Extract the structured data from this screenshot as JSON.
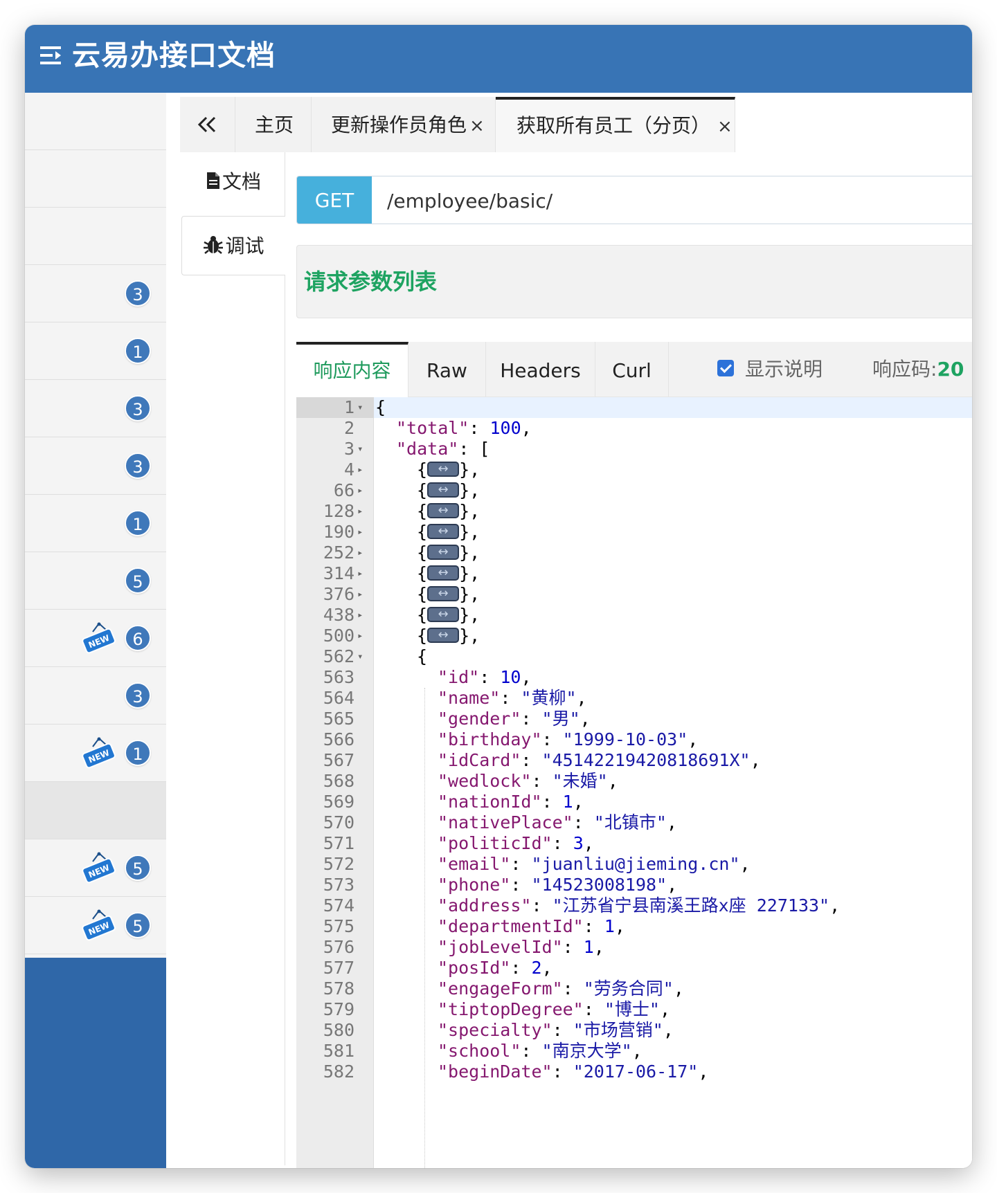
{
  "app": {
    "title": "云易办接口文档"
  },
  "sidebar": {
    "items": [
      {
        "badge": "",
        "is_new": false
      },
      {
        "badge": "",
        "is_new": false
      },
      {
        "badge": "",
        "is_new": false
      },
      {
        "badge": "3",
        "is_new": false
      },
      {
        "badge": "1",
        "is_new": false
      },
      {
        "badge": "3",
        "is_new": false
      },
      {
        "badge": "3",
        "is_new": false
      },
      {
        "badge": "1",
        "is_new": false
      },
      {
        "badge": "5",
        "is_new": false
      },
      {
        "badge": "6",
        "is_new": true
      },
      {
        "badge": "3",
        "is_new": false
      },
      {
        "badge": "1",
        "is_new": true
      },
      {
        "badge": "",
        "is_new": false,
        "active": true
      },
      {
        "badge": "5",
        "is_new": true
      },
      {
        "badge": "5",
        "is_new": true
      }
    ],
    "new_tag_label": "NEW"
  },
  "tabs": {
    "back_icon": "double-chevron-left-icon",
    "items": [
      {
        "label": "主页",
        "closable": false
      },
      {
        "label": "更新操作员角色",
        "closable": true
      },
      {
        "label": "获取所有员工（分页）",
        "closable": true,
        "active": true
      }
    ],
    "close_glyph": "×"
  },
  "doc_tabs": [
    {
      "label": "文档",
      "icon": "document-icon"
    },
    {
      "label": "调试",
      "icon": "bug-icon",
      "active": true
    }
  ],
  "request": {
    "method": "GET",
    "url": "/employee/basic/"
  },
  "params": {
    "title": "请求参数列表"
  },
  "response": {
    "tabs": [
      {
        "label": "响应内容",
        "active": true
      },
      {
        "label": "Raw"
      },
      {
        "label": "Headers"
      },
      {
        "label": "Curl"
      }
    ],
    "show_desc_label": "显示说明",
    "show_desc_checked": true,
    "code_label": "响应码:",
    "code_value": "20"
  },
  "editor": {
    "lines": [
      {
        "n": "1",
        "fold": "open",
        "indent": 0,
        "tokens": [
          [
            "p",
            "{"
          ]
        ]
      },
      {
        "n": "2",
        "indent": 1,
        "tokens": [
          [
            "k",
            "\"total\""
          ],
          [
            "p",
            ": "
          ],
          [
            "n",
            "100"
          ],
          [
            "p",
            ","
          ]
        ]
      },
      {
        "n": "3",
        "fold": "open",
        "indent": 1,
        "tokens": [
          [
            "k",
            "\"data\""
          ],
          [
            "p",
            ": ["
          ]
        ]
      },
      {
        "n": "4",
        "fold": "closed",
        "indent": 2,
        "tokens": [
          [
            "p",
            "{"
          ],
          [
            "w",
            ""
          ],
          [
            "p",
            "},"
          ]
        ]
      },
      {
        "n": "66",
        "fold": "closed",
        "indent": 2,
        "tokens": [
          [
            "p",
            "{"
          ],
          [
            "w",
            ""
          ],
          [
            "p",
            "},"
          ]
        ]
      },
      {
        "n": "128",
        "fold": "closed",
        "indent": 2,
        "tokens": [
          [
            "p",
            "{"
          ],
          [
            "w",
            ""
          ],
          [
            "p",
            "},"
          ]
        ]
      },
      {
        "n": "190",
        "fold": "closed",
        "indent": 2,
        "tokens": [
          [
            "p",
            "{"
          ],
          [
            "w",
            ""
          ],
          [
            "p",
            "},"
          ]
        ]
      },
      {
        "n": "252",
        "fold": "closed",
        "indent": 2,
        "tokens": [
          [
            "p",
            "{"
          ],
          [
            "w",
            ""
          ],
          [
            "p",
            "},"
          ]
        ]
      },
      {
        "n": "314",
        "fold": "closed",
        "indent": 2,
        "tokens": [
          [
            "p",
            "{"
          ],
          [
            "w",
            ""
          ],
          [
            "p",
            "},"
          ]
        ]
      },
      {
        "n": "376",
        "fold": "closed",
        "indent": 2,
        "tokens": [
          [
            "p",
            "{"
          ],
          [
            "w",
            ""
          ],
          [
            "p",
            "},"
          ]
        ]
      },
      {
        "n": "438",
        "fold": "closed",
        "indent": 2,
        "tokens": [
          [
            "p",
            "{"
          ],
          [
            "w",
            ""
          ],
          [
            "p",
            "},"
          ]
        ]
      },
      {
        "n": "500",
        "fold": "closed",
        "indent": 2,
        "tokens": [
          [
            "p",
            "{"
          ],
          [
            "w",
            ""
          ],
          [
            "p",
            "},"
          ]
        ]
      },
      {
        "n": "562",
        "fold": "open",
        "indent": 2,
        "tokens": [
          [
            "p",
            "{"
          ]
        ]
      },
      {
        "n": "563",
        "indent": 3,
        "tokens": [
          [
            "k",
            "\"id\""
          ],
          [
            "p",
            ": "
          ],
          [
            "n",
            "10"
          ],
          [
            "p",
            ","
          ]
        ]
      },
      {
        "n": "564",
        "indent": 3,
        "tokens": [
          [
            "k",
            "\"name\""
          ],
          [
            "p",
            ": "
          ],
          [
            "s",
            "\"黄柳\""
          ],
          [
            "p",
            ","
          ]
        ]
      },
      {
        "n": "565",
        "indent": 3,
        "tokens": [
          [
            "k",
            "\"gender\""
          ],
          [
            "p",
            ": "
          ],
          [
            "s",
            "\"男\""
          ],
          [
            "p",
            ","
          ]
        ]
      },
      {
        "n": "566",
        "indent": 3,
        "tokens": [
          [
            "k",
            "\"birthday\""
          ],
          [
            "p",
            ": "
          ],
          [
            "s",
            "\"1999-10-03\""
          ],
          [
            "p",
            ","
          ]
        ]
      },
      {
        "n": "567",
        "indent": 3,
        "tokens": [
          [
            "k",
            "\"idCard\""
          ],
          [
            "p",
            ": "
          ],
          [
            "s",
            "\"45142219420818691X\""
          ],
          [
            "p",
            ","
          ]
        ]
      },
      {
        "n": "568",
        "indent": 3,
        "tokens": [
          [
            "k",
            "\"wedlock\""
          ],
          [
            "p",
            ": "
          ],
          [
            "s",
            "\"未婚\""
          ],
          [
            "p",
            ","
          ]
        ]
      },
      {
        "n": "569",
        "indent": 3,
        "tokens": [
          [
            "k",
            "\"nationId\""
          ],
          [
            "p",
            ": "
          ],
          [
            "n",
            "1"
          ],
          [
            "p",
            ","
          ]
        ]
      },
      {
        "n": "570",
        "indent": 3,
        "tokens": [
          [
            "k",
            "\"nativePlace\""
          ],
          [
            "p",
            ": "
          ],
          [
            "s",
            "\"北镇市\""
          ],
          [
            "p",
            ","
          ]
        ]
      },
      {
        "n": "571",
        "indent": 3,
        "tokens": [
          [
            "k",
            "\"politicId\""
          ],
          [
            "p",
            ": "
          ],
          [
            "n",
            "3"
          ],
          [
            "p",
            ","
          ]
        ]
      },
      {
        "n": "572",
        "indent": 3,
        "tokens": [
          [
            "k",
            "\"email\""
          ],
          [
            "p",
            ": "
          ],
          [
            "s",
            "\"juanliu@jieming.cn\""
          ],
          [
            "p",
            ","
          ]
        ]
      },
      {
        "n": "573",
        "indent": 3,
        "tokens": [
          [
            "k",
            "\"phone\""
          ],
          [
            "p",
            ": "
          ],
          [
            "s",
            "\"14523008198\""
          ],
          [
            "p",
            ","
          ]
        ]
      },
      {
        "n": "574",
        "indent": 3,
        "tokens": [
          [
            "k",
            "\"address\""
          ],
          [
            "p",
            ": "
          ],
          [
            "s",
            "\"江苏省宁县南溪王路x座 227133\""
          ],
          [
            "p",
            ","
          ]
        ]
      },
      {
        "n": "575",
        "indent": 3,
        "tokens": [
          [
            "k",
            "\"departmentId\""
          ],
          [
            "p",
            ": "
          ],
          [
            "n",
            "1"
          ],
          [
            "p",
            ","
          ]
        ]
      },
      {
        "n": "576",
        "indent": 3,
        "tokens": [
          [
            "k",
            "\"jobLevelId\""
          ],
          [
            "p",
            ": "
          ],
          [
            "n",
            "1"
          ],
          [
            "p",
            ","
          ]
        ]
      },
      {
        "n": "577",
        "indent": 3,
        "tokens": [
          [
            "k",
            "\"posId\""
          ],
          [
            "p",
            ": "
          ],
          [
            "n",
            "2"
          ],
          [
            "p",
            ","
          ]
        ]
      },
      {
        "n": "578",
        "indent": 3,
        "tokens": [
          [
            "k",
            "\"engageForm\""
          ],
          [
            "p",
            ": "
          ],
          [
            "s",
            "\"劳务合同\""
          ],
          [
            "p",
            ","
          ]
        ]
      },
      {
        "n": "579",
        "indent": 3,
        "tokens": [
          [
            "k",
            "\"tiptopDegree\""
          ],
          [
            "p",
            ": "
          ],
          [
            "s",
            "\"博士\""
          ],
          [
            "p",
            ","
          ]
        ]
      },
      {
        "n": "580",
        "indent": 3,
        "tokens": [
          [
            "k",
            "\"specialty\""
          ],
          [
            "p",
            ": "
          ],
          [
            "s",
            "\"市场营销\""
          ],
          [
            "p",
            ","
          ]
        ]
      },
      {
        "n": "581",
        "indent": 3,
        "tokens": [
          [
            "k",
            "\"school\""
          ],
          [
            "p",
            ": "
          ],
          [
            "s",
            "\"南京大学\""
          ],
          [
            "p",
            ","
          ]
        ]
      },
      {
        "n": "582",
        "indent": 3,
        "tokens": [
          [
            "k",
            "\"beginDate\""
          ],
          [
            "p",
            ": "
          ],
          [
            "s",
            "\"2017-06-17\""
          ],
          [
            "p",
            ","
          ]
        ]
      }
    ]
  }
}
